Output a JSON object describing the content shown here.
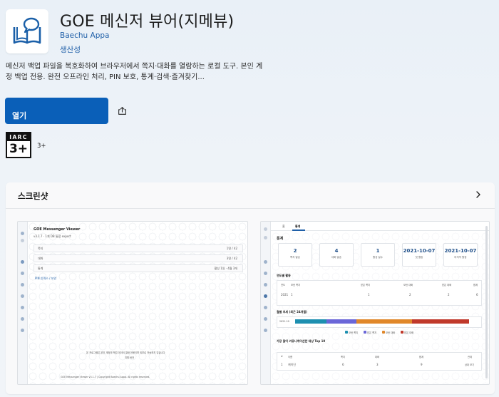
{
  "app": {
    "title": "GOE 메신저 뷰어(지메뷰)",
    "publisher": "Baechu Appa",
    "category": "생산성",
    "description": "메신저 백업 파일을 복호화하여 브라우저에서 쪽지·대화를 열람하는 로컬 도구. 본인 계정 백업 전용. 완전 오프라인 처리, PIN 보호, 통계·검색·즐겨찾기..."
  },
  "actions": {
    "open_label": "열기"
  },
  "rating": {
    "iarc_label": "IARC",
    "age_badge": "3+",
    "age_text": "3+"
  },
  "screenshots": {
    "title": "스크린샷",
    "shot1": {
      "app_name": "GOE Messenger Viewer",
      "subtitle": "v3.1.7 · 1개 DB 통합 export",
      "rows": [
        {
          "label": "쪽지",
          "value": "1명 / 42"
        },
        {
          "label": "대화",
          "value": "3명 / 42"
        },
        {
          "label": "통계",
          "value": "활성 1일 · 4월 3개"
        }
      ],
      "link": "PIN 인덱스 / 보안",
      "footer_lines": [
        "본 프로그램은 본인 계정의 백업 데이터 열람 전용이며 외부로 전송하지 않습니다",
        "지원 버전",
        "GOE Messenger Viewer v3.1.7 | Copyright Baechu Appa. All rights reserved."
      ]
    },
    "shot2": {
      "tabs": [
        "홈",
        "통계"
      ],
      "section_title": "통계",
      "cards": [
        {
          "value": "2",
          "label": "쪽지 발송"
        },
        {
          "value": "4",
          "label": "대화 발송"
        },
        {
          "value": "1",
          "label": "활성 일수"
        },
        {
          "value": "2021-10-07",
          "label": "첫 활동"
        },
        {
          "value": "2021-10-07",
          "label": "마지막 활동"
        }
      ],
      "yearly_title": "연도별 활동",
      "year_headers": [
        "연도",
        "보낸 쪽지",
        "받은 쪽지",
        "보낸 대화",
        "받은 대화",
        "합계"
      ],
      "year_row": {
        "year": "2021",
        "sent_note": "1",
        "recv_note": "1",
        "sent_chat": "2",
        "recv_chat": "2",
        "total": "6"
      },
      "monthly_title": "월별 추세 (최근 24개월)",
      "month_label": "2021-10",
      "legend": [
        "보낸 쪽지",
        "받은 쪽지",
        "보낸 대화",
        "받은 대화"
      ],
      "legend_colors": [
        "#1d8fb0",
        "#6a66d8",
        "#e0872a",
        "#c0392b"
      ],
      "top_title": "가장 많이 커뮤니케이션한 대상 Top 10",
      "top_headers": [
        "#",
        "이름",
        "쪽지",
        "대화",
        "합계",
        "관계"
      ],
      "top_row": {
        "rank": "1",
        "name": "케이딘",
        "note": "6",
        "chat": "3",
        "sum": "9",
        "rel": "상대 보기"
      }
    }
  }
}
